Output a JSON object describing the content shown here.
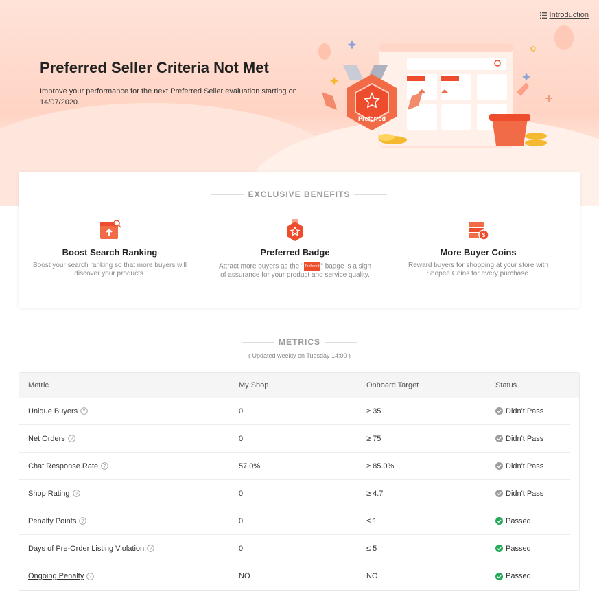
{
  "header": {
    "intro_label": "Introduction",
    "title": "Preferred Seller Criteria Not Met",
    "subtitle": "Improve your performance for the next Preferred Seller evaluation starting on 14/07/2020.",
    "illustration": {
      "badge_text": "Preferred",
      "card_tag": "Preferred"
    }
  },
  "benefits": {
    "heading": "EXCLUSIVE BENEFITS",
    "items": [
      {
        "title": "Boost Search Ranking",
        "desc": "Boost your search ranking so that more buyers will discover your products.",
        "icon": "search-ranking-icon"
      },
      {
        "title": "Preferred Badge",
        "desc_pre": "Attract more buyers as the \"",
        "badge": "Preferred",
        "desc_post": "\" badge is a sign of assurance for your product and service quality.",
        "icon": "preferred-badge-icon"
      },
      {
        "title": "More Buyer Coins",
        "desc": "Reward buyers for shopping at your store with Shopee Coins for every purchase.",
        "icon": "coins-icon"
      }
    ]
  },
  "metrics": {
    "heading": "METRICS",
    "note": "( Updated weekly on Tuesday 14:00 )",
    "columns": [
      "Metric",
      "My Shop",
      "Onboard Target",
      "Status"
    ],
    "rows": [
      {
        "metric": "Unique Buyers",
        "shop": "0",
        "target": "≥ 35",
        "status": "Didn't Pass",
        "passed": false
      },
      {
        "metric": "Net Orders",
        "shop": "0",
        "target": "≥ 75",
        "status": "Didn't Pass",
        "passed": false
      },
      {
        "metric": "Chat Response Rate",
        "shop": "57.0%",
        "target": "≥ 85.0%",
        "status": "Didn't Pass",
        "passed": false
      },
      {
        "metric": "Shop Rating",
        "shop": "0",
        "target": "≥ 4.7",
        "status": "Didn't Pass",
        "passed": false
      },
      {
        "metric": "Penalty Points",
        "shop": "0",
        "target": "≤ 1",
        "status": "Passed",
        "passed": true
      },
      {
        "metric": "Days of Pre-Order Listing Violation",
        "shop": "0",
        "target": "≤ 5",
        "status": "Passed",
        "passed": true
      },
      {
        "metric": "Ongoing Penalty",
        "shop": "NO",
        "target": "NO",
        "status": "Passed",
        "passed": true
      }
    ]
  },
  "colors": {
    "accent": "#ee4d2d",
    "pass": "#26aa5a",
    "fail": "#9e9e9e"
  }
}
